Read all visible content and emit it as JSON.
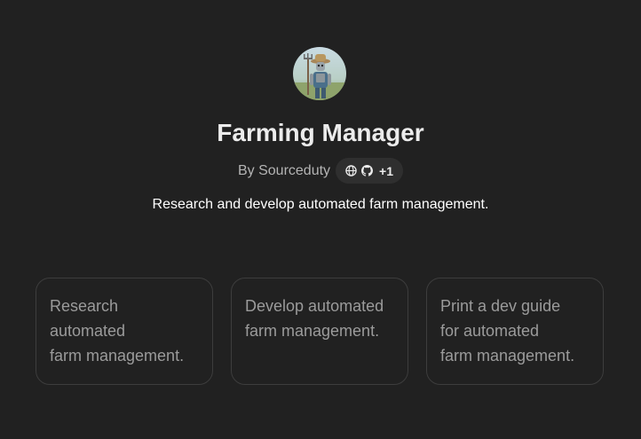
{
  "gpt": {
    "avatar_icon": "farmer-robot-avatar",
    "title": "Farming Manager",
    "author": "By Sourceduty",
    "links": {
      "icons": [
        "globe-icon",
        "github-icon"
      ],
      "extra_count": "+1"
    },
    "description": "Research and develop automated farm management."
  },
  "conversation_starters": [
    "Research\nautomated\nfarm management.",
    "Develop automated\nfarm management.",
    "Print a dev guide\nfor automated\nfarm management."
  ],
  "colors": {
    "background": "#212121",
    "card_border": "#3d3d3d",
    "pill_background": "#2f2f2f",
    "muted_text": "#9b9b9b"
  }
}
